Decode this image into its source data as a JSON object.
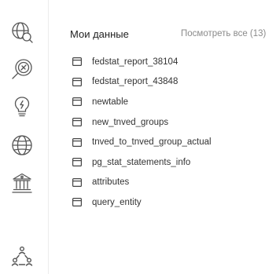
{
  "sidebar": {
    "icons": [
      {
        "name": "globe-search-icon"
      },
      {
        "name": "search-icon"
      },
      {
        "name": "lightbulb-icon"
      },
      {
        "name": "globe-icon"
      },
      {
        "name": "bank-icon"
      },
      {
        "name": "users-icon"
      }
    ]
  },
  "main": {
    "title": "Мои данные",
    "view_all_label": "Посмотреть все (13)",
    "items": [
      {
        "label": "fedstat_report_38104"
      },
      {
        "label": "fedstat_report_43848"
      },
      {
        "label": "newtable"
      },
      {
        "label": "new_tnved_groups"
      },
      {
        "label": "tnved_to_tnved_group_actual"
      },
      {
        "label": "pg_stat_statements_info"
      },
      {
        "label": "attributes"
      },
      {
        "label": "query_entity"
      }
    ]
  },
  "colors": {
    "icon_stroke": "#555555",
    "title_text": "#222222",
    "muted_text": "#8a8a8a",
    "sidebar_border": "#ececec"
  }
}
